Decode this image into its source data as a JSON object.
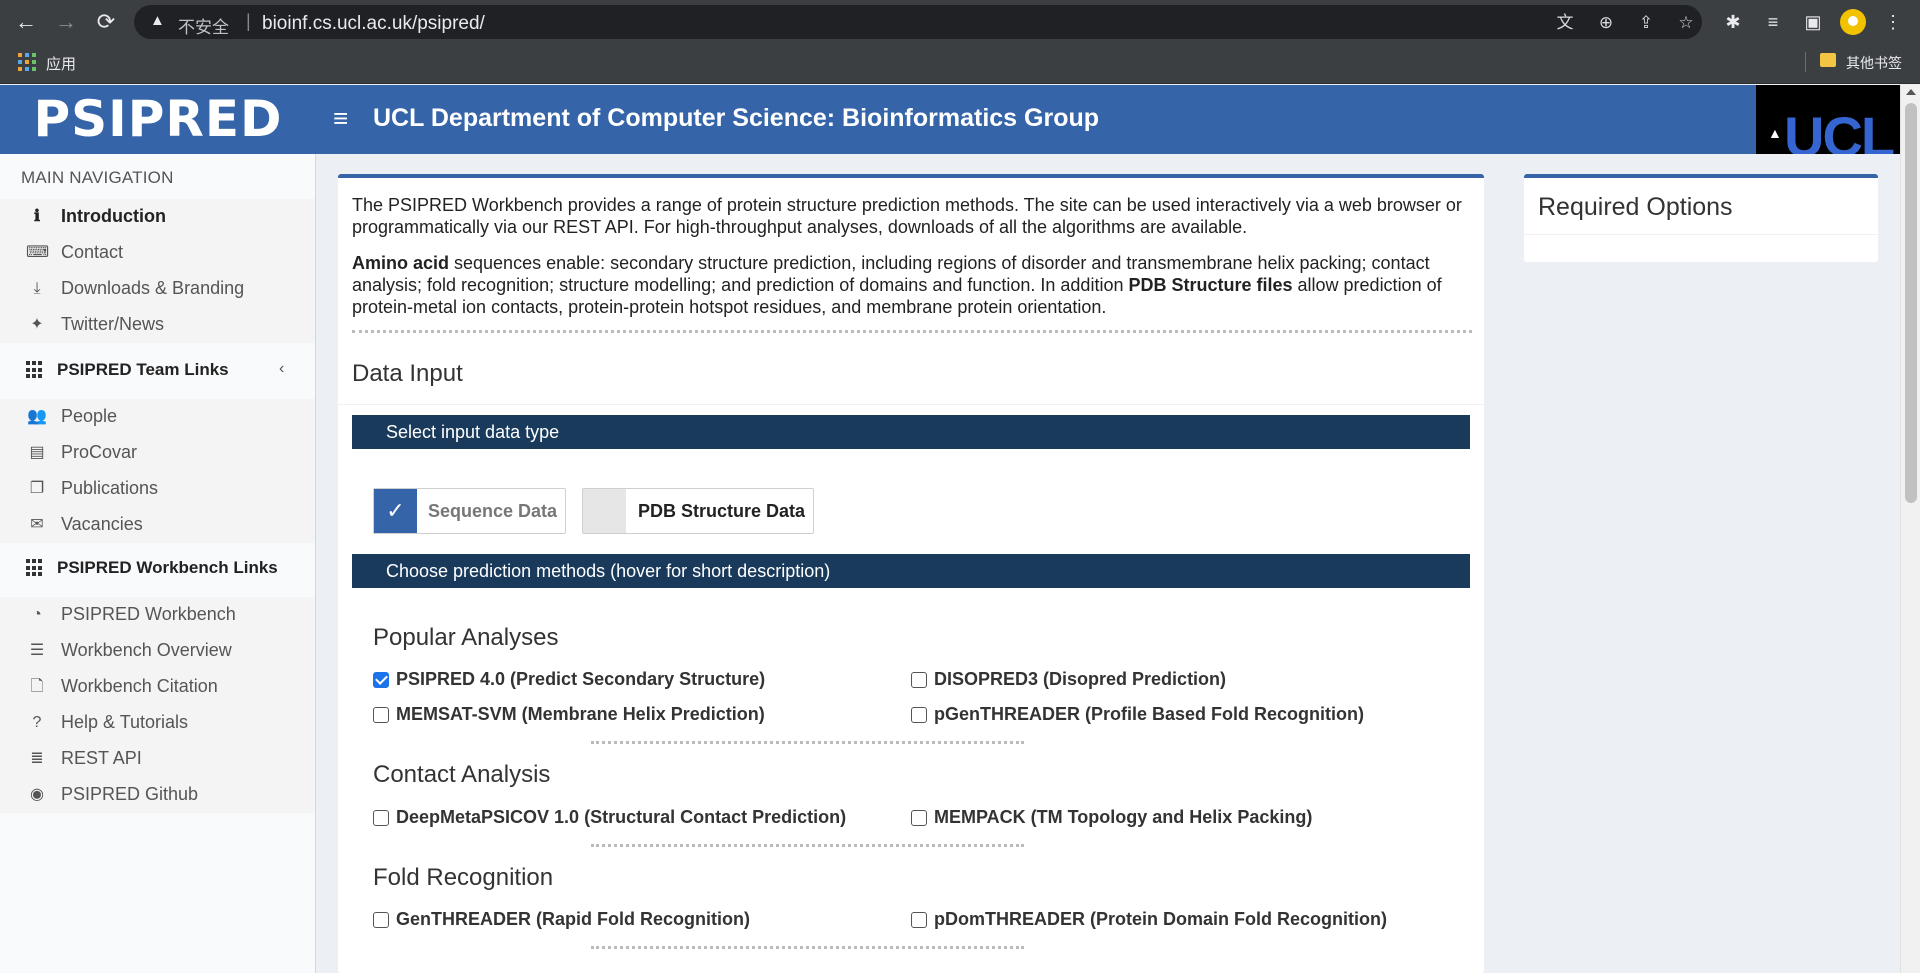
{
  "browser": {
    "nav_back": "←",
    "nav_forward": "→",
    "nav_reload": "⟳",
    "warning_icon": "▲",
    "insecure_label": "不安全",
    "url": "bioinf.cs.ucl.ac.uk/psipred/",
    "apps_label": "应用",
    "other_bookmarks": "其他书签",
    "menu_glyph": "⋮"
  },
  "header": {
    "brand": "PSIPRED",
    "menu_glyph": "≡",
    "title": "UCL Department of Computer Science: Bioinformatics Group",
    "ucl_logo": "UCL"
  },
  "sidebar": {
    "main_nav_label": "MAIN NAVIGATION",
    "main_items": [
      {
        "label": "Introduction",
        "icon": "info-icon",
        "glyph": "ℹ"
      },
      {
        "label": "Contact",
        "icon": "keyboard-icon",
        "glyph": "⌨"
      },
      {
        "label": "Downloads & Branding",
        "icon": "download-icon",
        "glyph": "⤓"
      },
      {
        "label": "Twitter/News",
        "icon": "twitter-icon",
        "glyph": "✦"
      }
    ],
    "team_links_label": "PSIPRED Team Links",
    "team_items": [
      {
        "label": "People",
        "icon": "users-icon",
        "glyph": "👥"
      },
      {
        "label": "ProCovar",
        "icon": "archive-icon",
        "glyph": "▤"
      },
      {
        "label": "Publications",
        "icon": "book-icon",
        "glyph": "❐"
      },
      {
        "label": "Vacancies",
        "icon": "envelope-icon",
        "glyph": "✉"
      }
    ],
    "workbench_links_label": "PSIPRED Workbench Links",
    "workbench_items": [
      {
        "label": "PSIPRED Workbench",
        "icon": "dashboard-icon",
        "glyph": "◔"
      },
      {
        "label": "Workbench Overview",
        "icon": "list-icon",
        "glyph": "☰"
      },
      {
        "label": "Workbench Citation",
        "icon": "file-icon",
        "glyph": "🗋"
      },
      {
        "label": "Help & Tutorials",
        "icon": "question-icon",
        "glyph": "?"
      },
      {
        "label": "REST API",
        "icon": "server-icon",
        "glyph": "≣"
      },
      {
        "label": "PSIPRED Github",
        "icon": "github-icon",
        "glyph": "◉"
      }
    ],
    "collapse_glyph": "‹"
  },
  "main": {
    "intro_p1": "The PSIPRED Workbench provides a range of protein structure prediction methods. The site can be used interactively via a web browser or programmatically via our REST API. For high-throughput analyses, downloads of all the algorithms are available.",
    "intro_p2_b1": "Amino acid",
    "intro_p2_t1": " sequences enable: secondary structure prediction, including regions of disorder and transmembrane helix packing; contact analysis; fold recognition; structure modelling; and prediction of domains and function. In addition ",
    "intro_p2_b2": "PDB Structure files",
    "intro_p2_t2": " allow prediction of protein-metal ion contacts, protein-protein hotspot residues, and membrane protein orientation.",
    "data_input_title": "Data Input",
    "select_input_bar": "Select input data type",
    "sequence_data": "Sequence Data",
    "pdb_data": "PDB Structure Data",
    "check_glyph": "✓",
    "choose_methods_bar": "Choose prediction methods (hover for short description)",
    "popular_title": "Popular Analyses",
    "popular": [
      {
        "label": "PSIPRED 4.0 (Predict Secondary Structure)",
        "checked": true
      },
      {
        "label": "DISOPRED3 (Disopred Prediction)",
        "checked": false
      },
      {
        "label": "MEMSAT-SVM (Membrane Helix Prediction)",
        "checked": false
      },
      {
        "label": "pGenTHREADER (Profile Based Fold Recognition)",
        "checked": false
      }
    ],
    "contact_title": "Contact Analysis",
    "contact": [
      {
        "label": "DeepMetaPSICOV 1.0 (Structural Contact Prediction)",
        "checked": false
      },
      {
        "label": "MEMPACK (TM Topology and Helix Packing)",
        "checked": false
      }
    ],
    "fold_title": "Fold Recognition",
    "fold": [
      {
        "label": "GenTHREADER (Rapid Fold Recognition)",
        "checked": false
      },
      {
        "label": "pDomTHREADER (Protein Domain Fold Recognition)",
        "checked": false
      }
    ]
  },
  "right": {
    "required_options_title": "Required Options"
  },
  "colors": {
    "header_blue": "#3565a8",
    "bar_navy": "#1a3a5c",
    "checkbox_blue": "#1a73e8",
    "chrome_dark": "#3c3f41"
  }
}
